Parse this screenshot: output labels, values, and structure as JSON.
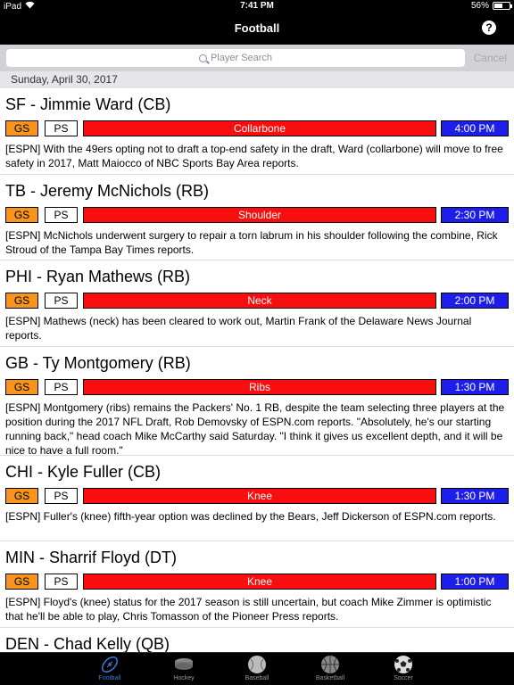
{
  "status": {
    "device": "iPad",
    "time": "7:41 PM",
    "battery": "56%",
    "battery_level": 0.56
  },
  "nav": {
    "title": "Football",
    "help": "?"
  },
  "search": {
    "placeholder": "Player Search",
    "cancel": "Cancel"
  },
  "date": "Sunday, April 30, 2017",
  "entries": [
    {
      "name": "SF - Jimmie Ward (CB)",
      "gs": "GS",
      "ps": "PS",
      "injury": "Collarbone",
      "time": "4:00 PM",
      "note": "[ESPN] With the 49ers opting not to draft a top-end safety in the draft, Ward (collarbone) will move to free safety in 2017, Matt Maiocco of NBC Sports Bay Area reports."
    },
    {
      "name": "TB - Jeremy McNichols (RB)",
      "gs": "GS",
      "ps": "PS",
      "injury": "Shoulder",
      "time": "2:30 PM",
      "note": "[ESPN] McNichols underwent surgery to repair a torn labrum in his shoulder following the combine, Rick Stroud of the Tampa Bay Times reports."
    },
    {
      "name": "PHI - Ryan Mathews (RB)",
      "gs": "GS",
      "ps": "PS",
      "injury": "Neck",
      "time": "2:00 PM",
      "note": "[ESPN] Mathews (neck) has been cleared to work out, Martin Frank of the Delaware News Journal reports."
    },
    {
      "name": "GB - Ty Montgomery (RB)",
      "gs": "GS",
      "ps": "PS",
      "injury": "Ribs",
      "time": "1:30 PM",
      "note": "[ESPN] Montgomery (ribs) remains the Packers' No. 1 RB, despite the team selecting three players at the position during the 2017 NFL Draft, Rob Demovsky of ESPN.com reports. \"Absolutely, he's our starting running back,\" head coach Mike McCarthy said Saturday. \"I think it gives us excellent depth, and it will be nice to have a full room.\""
    },
    {
      "name": "CHI - Kyle Fuller (CB)",
      "gs": "GS",
      "ps": "PS",
      "injury": "Knee",
      "time": "1:30 PM",
      "note": "[ESPN] Fuller's (knee) fifth-year option was declined by the Bears, Jeff Dickerson of ESPN.com reports."
    },
    {
      "name": "MIN - Sharrif Floyd (DT)",
      "gs": "GS",
      "ps": "PS",
      "injury": "Knee",
      "time": "1:00 PM",
      "note": "[ESPN] Floyd's (knee) status for the 2017 season is still uncertain, but coach Mike Zimmer is optimistic that he'll be able to play, Chris Tomasson of the Pioneer Press reports."
    },
    {
      "name": "DEN - Chad Kelly (QB)"
    }
  ],
  "tabs": [
    {
      "label": "Football",
      "icon": "football-icon",
      "active": true
    },
    {
      "label": "Hockey",
      "icon": "hockey-puck-icon"
    },
    {
      "label": "Baseball",
      "icon": "baseball-icon"
    },
    {
      "label": "Basketball",
      "icon": "basketball-icon"
    },
    {
      "label": "Soccer",
      "icon": "soccer-ball-icon"
    }
  ],
  "colors": {
    "gs": "#f7941d",
    "injury": "#f80e0e",
    "time": "#1e1eea",
    "active_tab": "#3b7dd8"
  }
}
